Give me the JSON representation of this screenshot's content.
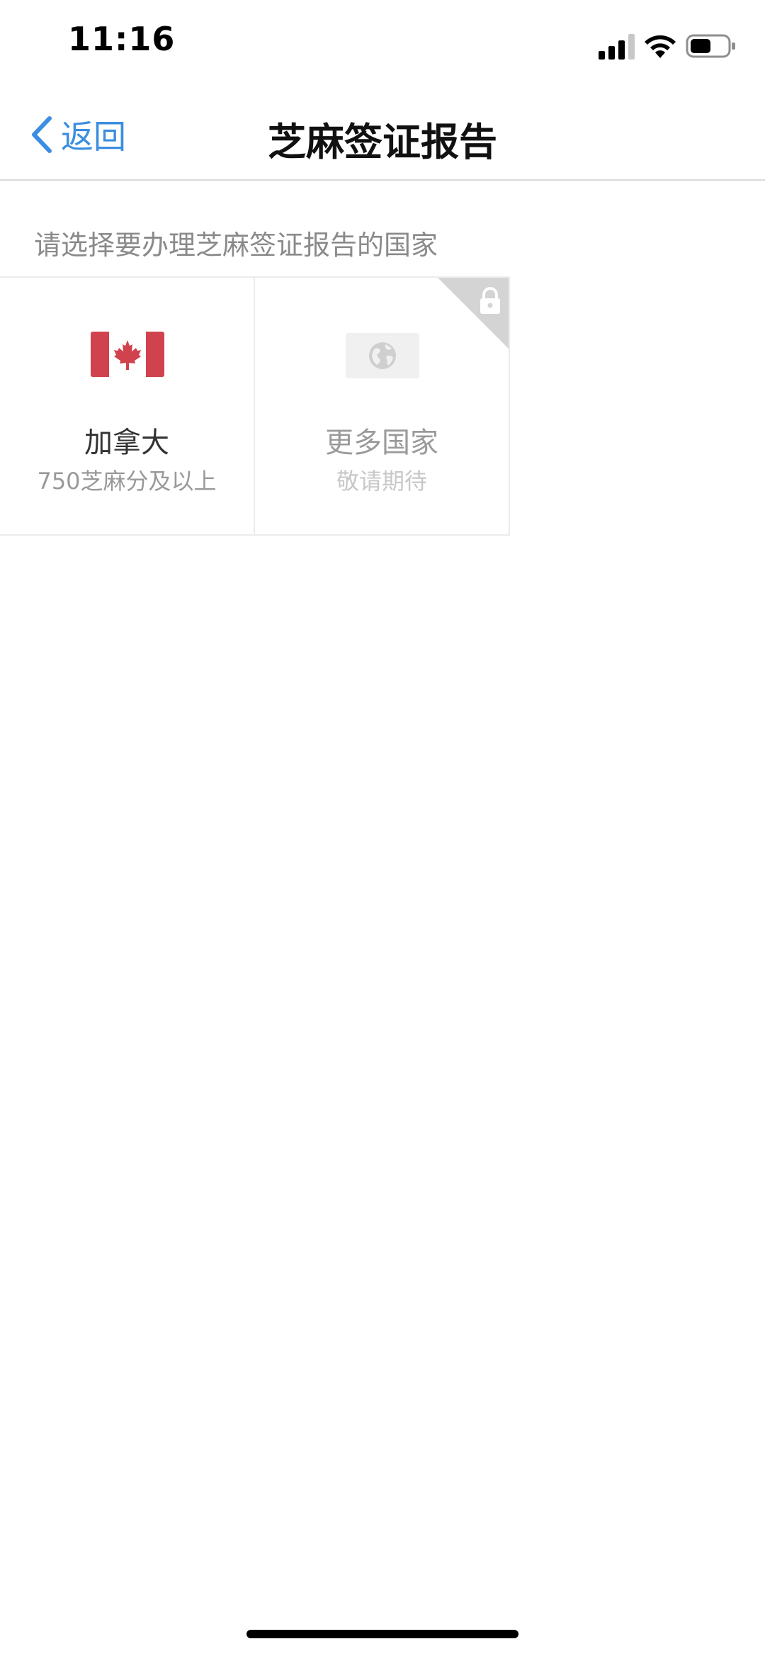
{
  "status_bar": {
    "time": "11:16",
    "icons": [
      "signal-icon",
      "wifi-icon",
      "battery-icon"
    ],
    "battery_level": 0.55
  },
  "nav": {
    "back_label": "返回",
    "title": "芝麻签证报告"
  },
  "section": {
    "label": "请选择要办理芝麻签证报告的国家"
  },
  "countries": [
    {
      "name": "加拿大",
      "subtitle": "750芝麻分及以上",
      "icon": "canada-flag-icon",
      "locked": false
    },
    {
      "name": "更多国家",
      "subtitle": "敬请期待",
      "icon": "globe-icon",
      "locked": true
    }
  ],
  "colors": {
    "accent": "#3b8ee0",
    "flag_red": "#d0434e",
    "lock_corner": "#d4d4d4"
  }
}
